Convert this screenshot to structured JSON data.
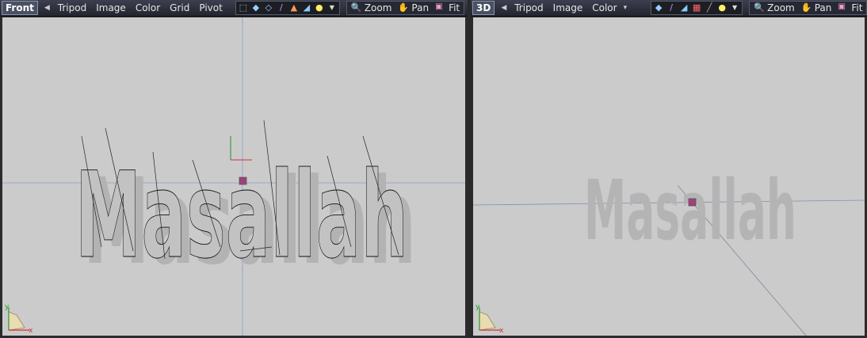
{
  "left_viewport": {
    "name": "Front",
    "menu": [
      "Tripod",
      "Image",
      "Color",
      "Grid",
      "Pivot"
    ],
    "zoom_label": "Zoom",
    "pan_label": "Pan",
    "fit_label": "Fit",
    "scene_text": "Masallah",
    "axis_y": "y",
    "axis_x": "x"
  },
  "right_viewport": {
    "name": "3D",
    "menu": [
      "Tripod",
      "Image",
      "Color"
    ],
    "zoom_label": "Zoom",
    "pan_label": "Pan",
    "fit_label": "Fit",
    "scene_text": "Masallah",
    "axis_y": "y",
    "axis_x": "x"
  },
  "colors": {
    "toolbar": "#2f3340",
    "canvas": "#cbcbcb",
    "pivot": "#a0407a",
    "grid_line": "#8aa0c8"
  }
}
